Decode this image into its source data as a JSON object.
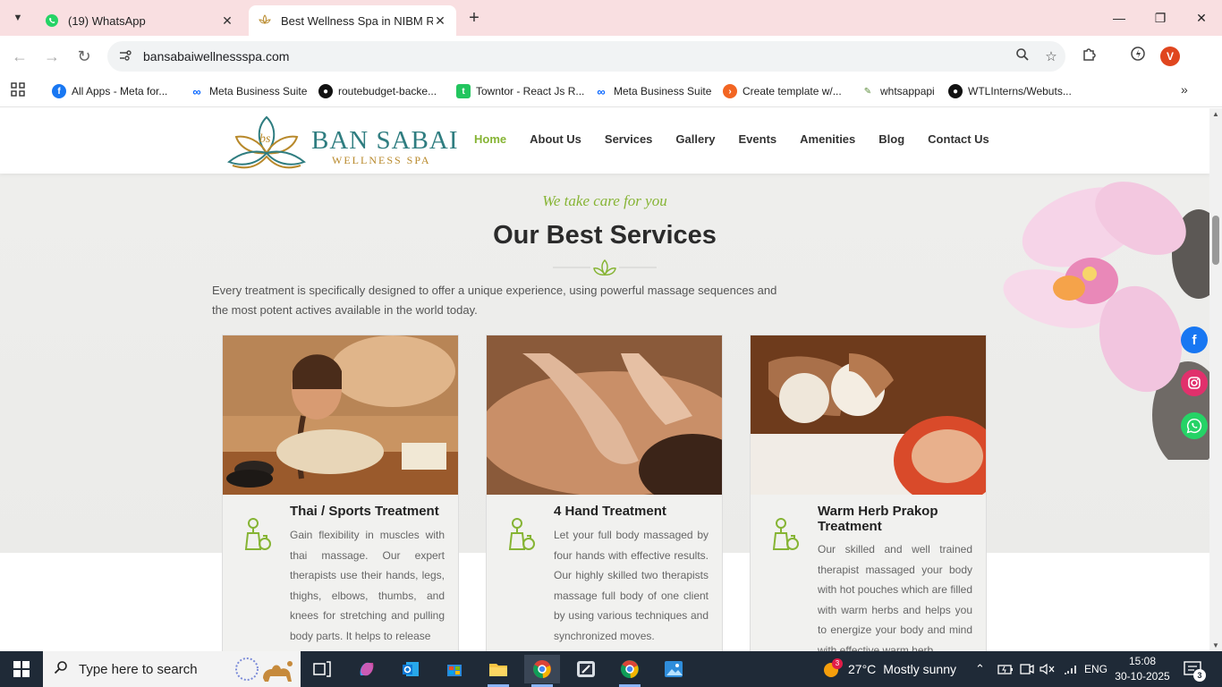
{
  "browser": {
    "tabs": [
      {
        "title": "(19) WhatsApp",
        "active": false
      },
      {
        "title": "Best Wellness Spa in NIBM Road",
        "active": true
      }
    ],
    "url": "bansabaiwellnessspa.com",
    "profile_initial": "V",
    "bookmarks": [
      {
        "label": "All Apps - Meta for...",
        "icon": "facebook-icon",
        "color": "#1877f2"
      },
      {
        "label": "Meta Business Suite",
        "icon": "meta-icon",
        "color": "#0866ff"
      },
      {
        "label": "routebudget-backe...",
        "icon": "github-icon",
        "color": "#111111"
      },
      {
        "label": "Towntor - React Js R...",
        "icon": "towntor-icon",
        "color": "#22c55e"
      },
      {
        "label": "Meta Business Suite",
        "icon": "meta-icon",
        "color": "#0866ff"
      },
      {
        "label": "Create template w/...",
        "icon": "template-icon",
        "color": "#f26522"
      },
      {
        "label": "whtsappapi",
        "icon": "whtsappapi-icon",
        "color": "#5b8c3a"
      },
      {
        "label": "WTLInterns/Webuts...",
        "icon": "github-icon",
        "color": "#111111"
      }
    ]
  },
  "site": {
    "logo": {
      "name": "BAN SABAI",
      "sub": "WELLNESS SPA",
      "mark_letters": "bs"
    },
    "nav": [
      "Home",
      "About Us",
      "Services",
      "Gallery",
      "Events",
      "Amenities",
      "Blog",
      "Contact Us"
    ],
    "nav_active": "Home",
    "tagline": "We take care for you",
    "heading": "Our Best Services",
    "intro": "Every treatment is specifically designed to offer a unique experience, using powerful massage sequences and the most potent actives available in the world today.",
    "cards": [
      {
        "title": "Thai / Sports Treatment",
        "desc": "Gain flexibility in muscles with thai massage. Our expert therapists use their hands, legs, thighs, elbows, thumbs, and knees for stretching and pulling body parts. It helps to release"
      },
      {
        "title": "4 Hand Treatment",
        "desc": "Let your full body massaged by four hands with effective results. Our highly skilled two therapists massage full body of one client by using various techniques and synchronized moves."
      },
      {
        "title": "Warm Herb Prakop Treatment",
        "desc": "Our skilled and well trained therapist massaged your body with hot pouches which are filled with warm herbs and helps you to energize your body and mind with effective warm herb"
      }
    ],
    "social": [
      "facebook-icon",
      "instagram-icon",
      "whatsapp-icon"
    ]
  },
  "taskbar": {
    "search_placeholder": "Type here to search",
    "weather": {
      "temp": "27°C",
      "condition": "Mostly sunny",
      "badge": "3"
    },
    "language": "ENG",
    "time": "15:08",
    "date": "30-10-2025",
    "notifications": "3"
  },
  "colors": {
    "accent_green": "#86b434",
    "teal": "#2f7d80",
    "gold": "#b8892b",
    "tab_strip": "#f9dfe1"
  }
}
